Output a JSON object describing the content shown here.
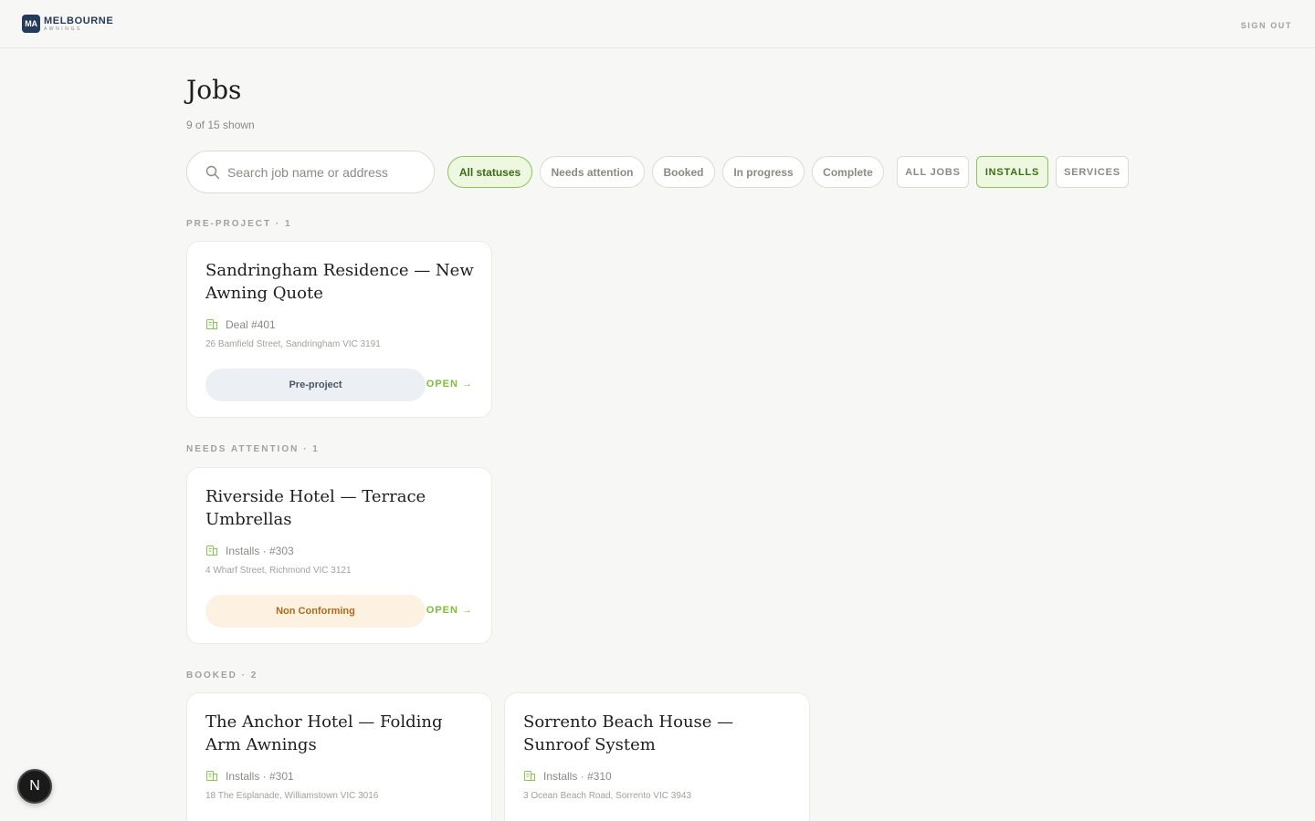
{
  "header": {
    "logo_badge": "MA",
    "logo_name": "MELBOURNE",
    "logo_sub": "AWNINGS",
    "signout": "SIGN OUT"
  },
  "page": {
    "title": "Jobs",
    "shown": "9 of 15 shown"
  },
  "search": {
    "placeholder": "Search job name or address",
    "value": ""
  },
  "status_filters": [
    {
      "label": "All statuses",
      "active": true
    },
    {
      "label": "Needs attention",
      "active": false
    },
    {
      "label": "Booked",
      "active": false
    },
    {
      "label": "In progress",
      "active": false
    },
    {
      "label": "Complete",
      "active": false
    }
  ],
  "type_filters": [
    {
      "label": "ALL JOBS",
      "active": false
    },
    {
      "label": "INSTALLS",
      "active": true
    },
    {
      "label": "SERVICES",
      "active": false
    }
  ],
  "sections": [
    {
      "label": "PRE-PROJECT · 1",
      "cards": [
        {
          "title": "Sandringham Residence — New Awning Quote",
          "meta": "Deal #401",
          "address": "26 Bamfield Street, Sandringham VIC 3191",
          "status": "Pre-project",
          "open": "OPEN →"
        }
      ]
    },
    {
      "label": "NEEDS ATTENTION · 1",
      "cards": [
        {
          "title": "Riverside Hotel — Terrace Umbrellas",
          "meta": "Installs · #303",
          "address": "4 Wharf Street, Richmond VIC 3121",
          "status": "Non Conforming",
          "open": "OPEN →"
        }
      ]
    },
    {
      "label": "BOOKED · 2",
      "cards": [
        {
          "title": "The Anchor Hotel — Folding Arm Awnings",
          "meta": "Installs · #301",
          "address": "18 The Esplanade, Williamstown VIC 3016"
        },
        {
          "title": "Sorrento Beach House — Sunroof System",
          "meta": "Installs · #310",
          "address": "3 Ocean Beach Road, Sorrento VIC 3943"
        }
      ]
    }
  ],
  "fab_label": "N",
  "colors": {
    "accent": "#7bbf3a",
    "active_pill_bg": "#eef7e0",
    "brand": "#243b5c"
  }
}
